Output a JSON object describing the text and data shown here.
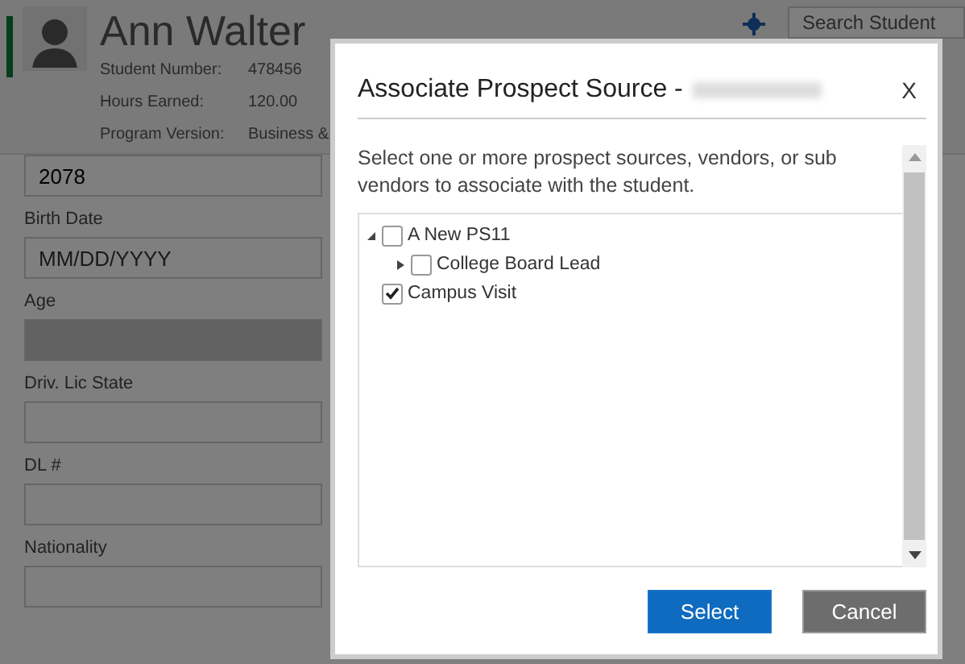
{
  "header": {
    "name": "Ann Walter",
    "details": [
      {
        "label": "Student Number:",
        "value": "478456"
      },
      {
        "label": "Hours Earned:",
        "value": "120.00"
      },
      {
        "label": "Program Version:",
        "value": "Business &"
      }
    ],
    "search": {
      "placeholder": "Search Student"
    }
  },
  "form": {
    "fields": [
      {
        "value": "2078",
        "disabled": false
      },
      {
        "label": "Birth Date",
        "placeholder": "MM/DD/YYYY",
        "disabled": false
      },
      {
        "label": "Age",
        "disabled": true
      },
      {
        "label": "Driv. Lic State",
        "disabled": false
      },
      {
        "label": "DL #",
        "disabled": false
      },
      {
        "label": "Nationality",
        "disabled": false
      }
    ]
  },
  "dialog": {
    "title": "Associate Prospect Source -",
    "close": "X",
    "description": "Select one or more prospect sources, vendors, or sub vendors to associate with the student.",
    "tree": [
      {
        "label": "A New PS11",
        "checked": false,
        "expanded": true,
        "children": [
          {
            "label": "College Board Lead",
            "checked": false,
            "expanded": false
          }
        ]
      },
      {
        "label": "Campus Visit",
        "checked": true
      }
    ],
    "buttons": [
      {
        "label": "Select",
        "kind": "primary"
      },
      {
        "label": "Cancel",
        "kind": "secondary"
      }
    ]
  }
}
